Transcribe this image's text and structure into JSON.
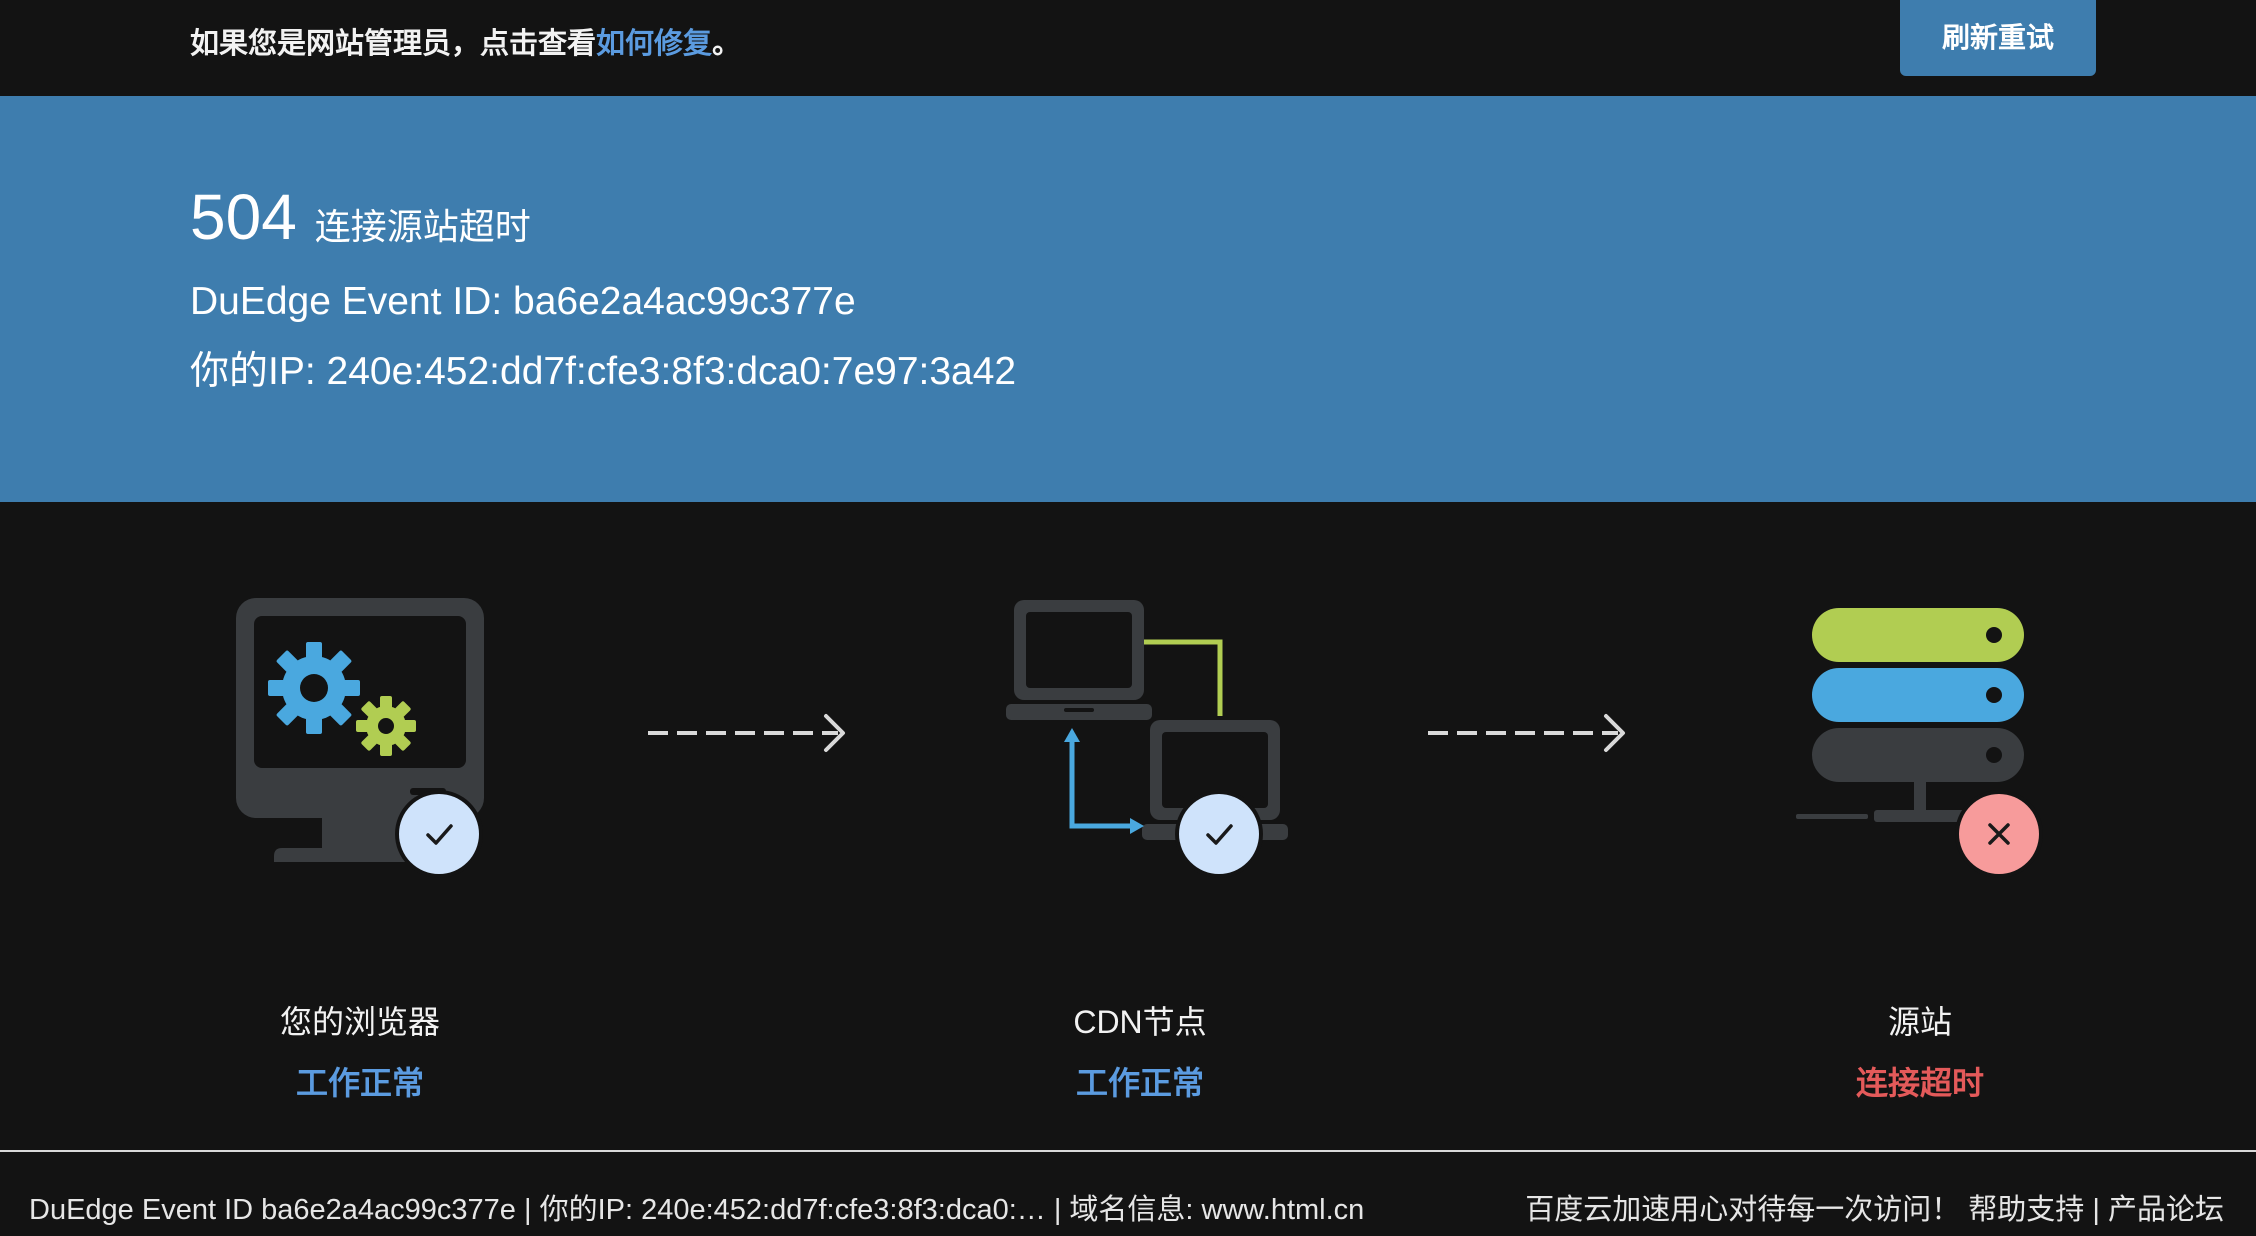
{
  "topbar": {
    "message_prefix": "如果您是网站管理员，点击查看",
    "message_link": "如何修复",
    "message_suffix": "。",
    "refresh_label": "刷新重试"
  },
  "banner": {
    "error_code": "504",
    "error_text": "连接源站超时",
    "event_id_line": "DuEdge Event ID: ba6e2a4ac99c377e",
    "ip_line": "你的IP: 240e:452:dd7f:cfe3:8f3:dca0:7e97:3a42"
  },
  "nodes": [
    {
      "label": "您的浏览器",
      "status": "工作正常",
      "state": "ok",
      "icon": "monitor-gears-icon",
      "badge": "check-icon"
    },
    {
      "label": "CDN节点",
      "status": "工作正常",
      "state": "ok",
      "icon": "network-computers-icon",
      "badge": "check-icon"
    },
    {
      "label": "源站",
      "status": "连接超时",
      "state": "error",
      "icon": "server-stack-icon",
      "badge": "cross-icon"
    }
  ],
  "footer": {
    "left_text": "DuEdge Event ID ba6e2a4ac99c377e | 你的IP: 240e:452:dd7f:cfe3:8f3:dca0:…  | 域名信息: www.html.cn",
    "slogan": "百度云加速用心对待每一次访问！",
    "help_link": "帮助支持",
    "separator": "|",
    "forum_link": "产品论坛"
  },
  "colors": {
    "banner_blue": "#3e7dae",
    "background": "#131313",
    "ok_blue": "#5b9be0",
    "error_red": "#e45a5a",
    "badge_ok": "#cfe3fb",
    "badge_err": "#f79b9b",
    "green": "#b1cd52",
    "cyan": "#4aa8df",
    "dark_gray": "#3a3d40"
  }
}
